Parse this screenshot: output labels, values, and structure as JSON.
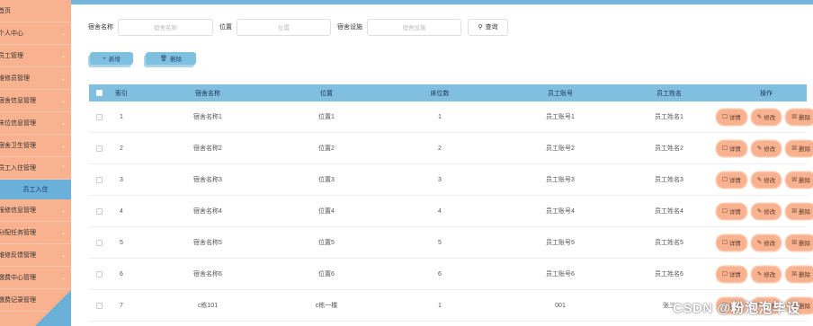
{
  "sidebar": {
    "items": [
      {
        "label": "首页",
        "chevron": false
      },
      {
        "label": "个人中心",
        "chevron": true
      },
      {
        "label": "员工管理",
        "chevron": true
      },
      {
        "label": "维修员管理",
        "chevron": true
      },
      {
        "label": "宿舍信息管理",
        "chevron": true
      },
      {
        "label": "床位信息管理",
        "chevron": true
      },
      {
        "label": "宿舍卫生管理",
        "chevron": true
      },
      {
        "label": "员工入住管理",
        "chevron": true,
        "expanded": true
      }
    ],
    "active_sub": "员工入住",
    "items_after": [
      {
        "label": "报修信息管理",
        "chevron": true
      },
      {
        "label": "分配任务管理",
        "chevron": true
      },
      {
        "label": "维修反馈管理",
        "chevron": true
      },
      {
        "label": "缴费中心管理",
        "chevron": true
      },
      {
        "label": "缴费记录管理",
        "chevron": true
      }
    ]
  },
  "search": {
    "dorm_name_label": "宿舍名称",
    "dorm_name_placeholder": "宿舍名称",
    "position_label": "位置",
    "position_placeholder": "位置",
    "facility_label": "宿舍设施",
    "facility_placeholder": "宿舍设施",
    "query_label": "查询"
  },
  "toolbar": {
    "add_label": "新增",
    "delete_label": "删除"
  },
  "table": {
    "headers": {
      "index": "索引",
      "dorm_name": "宿舍名称",
      "position": "位置",
      "beds": "床位数",
      "emp_account": "员工账号",
      "emp_name": "员工姓名",
      "ops": "操作"
    },
    "op_labels": {
      "detail": "详情",
      "edit": "修改",
      "delete": "删除"
    },
    "rows": [
      {
        "index": "1",
        "dorm_name": "宿舍名称1",
        "position": "位置1",
        "beds": "1",
        "emp_account": "员工账号1",
        "emp_name": "员工姓名1"
      },
      {
        "index": "2",
        "dorm_name": "宿舍名称2",
        "position": "位置2",
        "beds": "2",
        "emp_account": "员工账号2",
        "emp_name": "员工姓名2"
      },
      {
        "index": "3",
        "dorm_name": "宿舍名称3",
        "position": "位置3",
        "beds": "3",
        "emp_account": "员工账号3",
        "emp_name": "员工姓名3"
      },
      {
        "index": "4",
        "dorm_name": "宿舍名称4",
        "position": "位置4",
        "beds": "4",
        "emp_account": "员工账号4",
        "emp_name": "员工姓名4"
      },
      {
        "index": "5",
        "dorm_name": "宿舍名称5",
        "position": "位置5",
        "beds": "5",
        "emp_account": "员工账号5",
        "emp_name": "员工姓名5"
      },
      {
        "index": "6",
        "dorm_name": "宿舍名称6",
        "position": "位置6",
        "beds": "6",
        "emp_account": "员工账号6",
        "emp_name": "员工姓名6"
      },
      {
        "index": "7",
        "dorm_name": "c栋101",
        "position": "c栋一楼",
        "beds": "1",
        "emp_account": "001",
        "emp_name": "张三"
      }
    ]
  },
  "watermark": "CSDN @粉泡泡毕设",
  "colors": {
    "sidebar_bg": "#f9b290",
    "accent_blue": "#80bfdf",
    "op_button": "#f9b290"
  }
}
